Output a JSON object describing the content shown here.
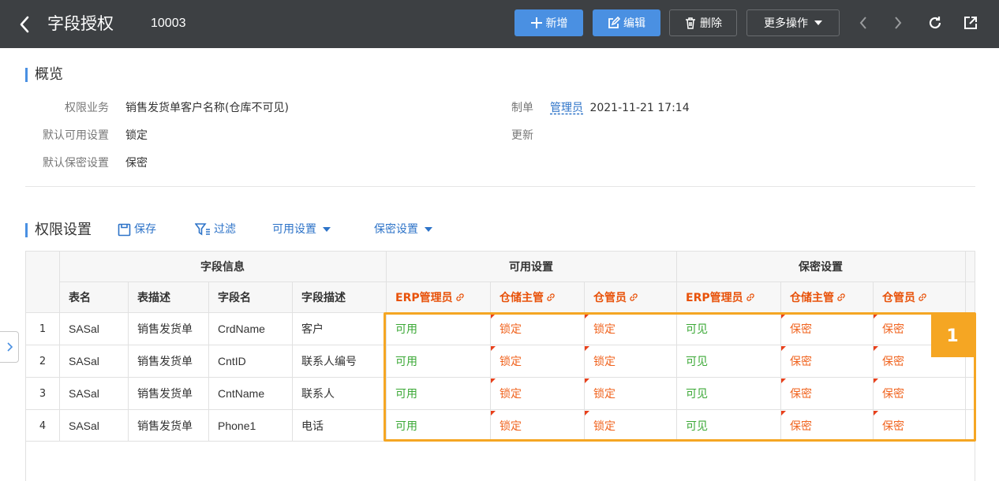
{
  "header": {
    "title": "字段授权",
    "doc_no": "10003",
    "buttons": {
      "add": "新增",
      "edit": "编辑",
      "delete": "删除",
      "more": "更多操作"
    }
  },
  "overview": {
    "title": "概览",
    "fields": {
      "perm_business_label": "权限业务",
      "perm_business_value": "销售发货单客户名称(仓库不可见)",
      "default_avail_label": "默认可用设置",
      "default_avail_value": "锁定",
      "default_secret_label": "默认保密设置",
      "default_secret_value": "保密",
      "creator_label": "制单",
      "creator_user": "管理员",
      "creator_time": "2021-11-21 17:14",
      "update_label": "更新"
    }
  },
  "perm_settings": {
    "title": "权限设置",
    "toolbar": {
      "save": "保存",
      "filter": "过滤",
      "avail": "可用设置",
      "secret": "保密设置"
    }
  },
  "table": {
    "groups": {
      "field_info": "字段信息",
      "avail": "可用设置",
      "secret": "保密设置"
    },
    "columns": {
      "table_name": "表名",
      "table_desc": "表描述",
      "field_name": "字段名",
      "field_desc": "字段描述",
      "roles": [
        "ERP管理员",
        "仓储主管",
        "仓管员",
        "ERP管理员",
        "仓储主管",
        "仓管员"
      ]
    },
    "rows": [
      {
        "no": "1",
        "table": "SASal",
        "desc": "销售发货单",
        "field": "CrdName",
        "fdesc": "客户",
        "perms": [
          "可用",
          "锁定",
          "锁定",
          "可见",
          "保密",
          "保密"
        ]
      },
      {
        "no": "2",
        "table": "SASal",
        "desc": "销售发货单",
        "field": "CntID",
        "fdesc": "联系人编号",
        "perms": [
          "可用",
          "锁定",
          "锁定",
          "可见",
          "保密",
          "保密"
        ]
      },
      {
        "no": "3",
        "table": "SASal",
        "desc": "销售发货单",
        "field": "CntName",
        "fdesc": "联系人",
        "perms": [
          "可用",
          "锁定",
          "锁定",
          "可见",
          "保密",
          "保密"
        ]
      },
      {
        "no": "4",
        "table": "SASal",
        "desc": "销售发货单",
        "field": "Phone1",
        "fdesc": "电话",
        "perms": [
          "可用",
          "锁定",
          "锁定",
          "可见",
          "保密",
          "保密"
        ]
      }
    ]
  },
  "annotation": {
    "badge": "1"
  },
  "colors": {
    "header_bg": "#3d4043",
    "primary": "#4a90e2",
    "link": "#2d73c8",
    "green": "#3aa835",
    "orange": "#f0631e",
    "highlight": "#f5a623"
  }
}
